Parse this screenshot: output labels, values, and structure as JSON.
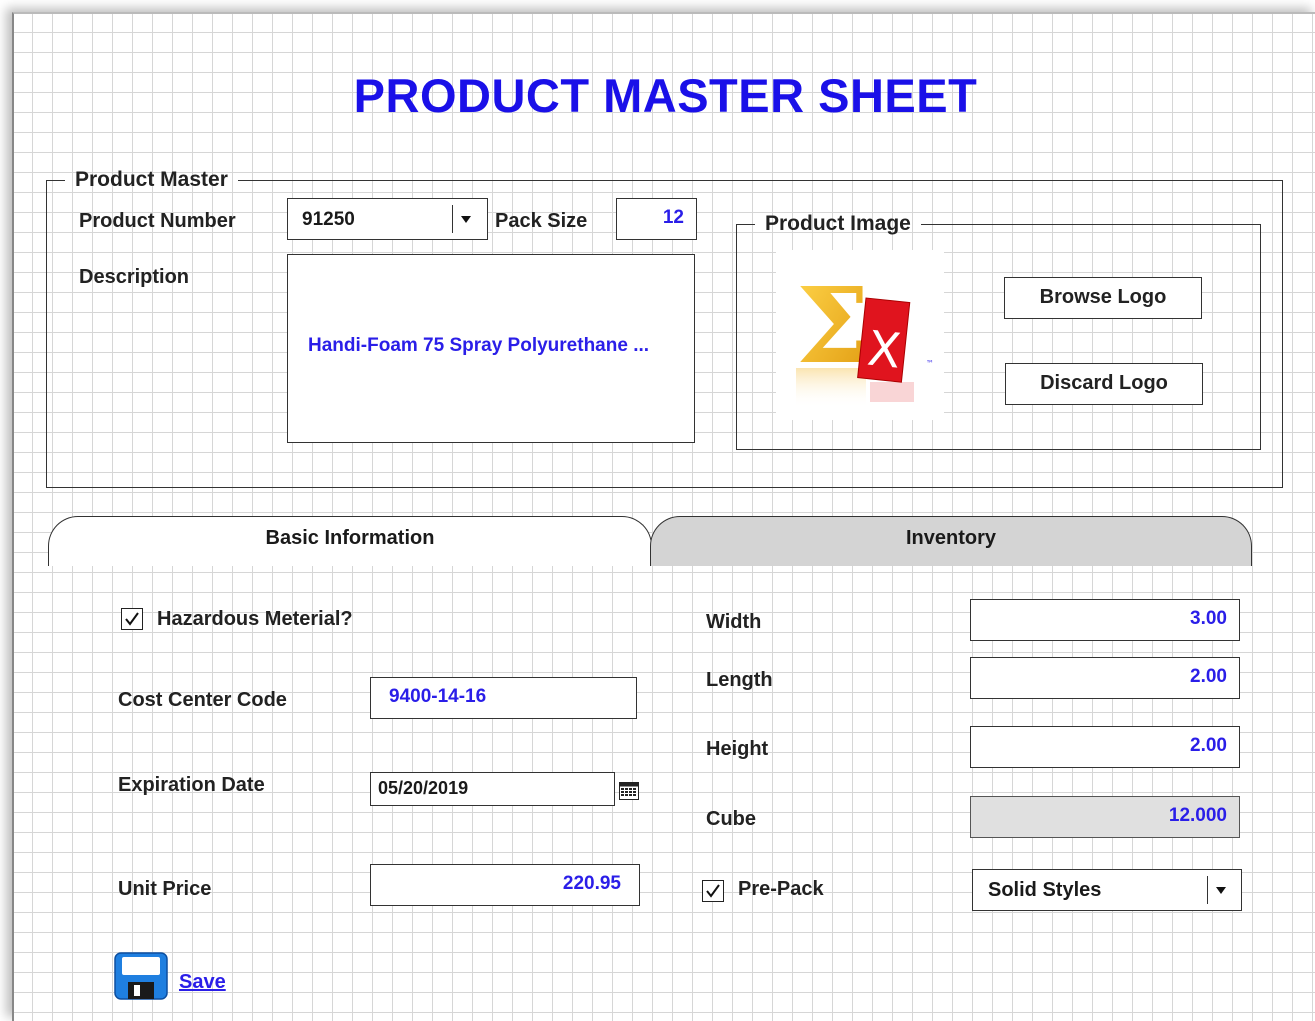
{
  "title": "PRODUCT MASTER SHEET",
  "product_master": {
    "legend": "Product Master",
    "product_number_label": "Product Number",
    "product_number_value": "91250",
    "pack_size_label": "Pack Size",
    "pack_size_value": "12",
    "description_label": "Description",
    "description_value": "Handi-Foam 75 Spray Polyurethane ..."
  },
  "product_image": {
    "legend": "Product Image",
    "logo_symbols": [
      "Σ",
      "X",
      "™"
    ],
    "browse_label": "Browse Logo",
    "discard_label": "Discard Logo"
  },
  "tabs": [
    {
      "label": "Basic Information",
      "active": true
    },
    {
      "label": "Inventory",
      "active": false
    }
  ],
  "basic": {
    "hazardous_label": "Hazardous Meterial?",
    "hazardous_checked": true,
    "cost_center_label": "Cost Center Code",
    "cost_center_value": "9400-14-16",
    "expiration_label": "Expiration Date",
    "expiration_value": "05/20/2019",
    "unit_price_label": "Unit Price",
    "unit_price_value": "220.95",
    "save_label": "Save"
  },
  "dimensions": {
    "width_label": "Width",
    "width_value": "3.00",
    "length_label": "Length",
    "length_value": "2.00",
    "height_label": "Height",
    "height_value": "2.00",
    "cube_label": "Cube",
    "cube_value": "12.000",
    "prepack_label": "Pre-Pack",
    "prepack_checked": true,
    "style_value": "Solid Styles"
  },
  "colors": {
    "accent_blue": "#1a10e8",
    "value_blue": "#2a1ee8",
    "inactive_tab": "#d4d4d4",
    "disabled_field": "#e0e0e0",
    "logo_gold": "#f2b21c",
    "logo_red": "#e0141e",
    "save_icon_blue": "#1f7fe0"
  }
}
